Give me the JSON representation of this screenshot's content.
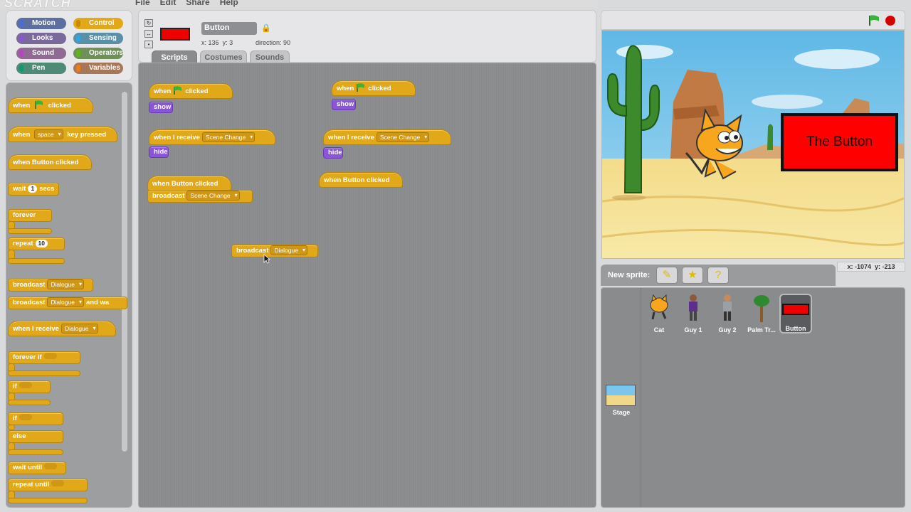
{
  "app": {
    "logo": "SCRATCH",
    "menu": [
      "File",
      "Edit",
      "Share",
      "Help"
    ]
  },
  "categories": [
    {
      "label": "Motion",
      "color": "#4a6cd4"
    },
    {
      "label": "Control",
      "color": "#e1a91a"
    },
    {
      "label": "Looks",
      "color": "#8a55d7"
    },
    {
      "label": "Sensing",
      "color": "#2ca5e2"
    },
    {
      "label": "Sound",
      "color": "#bb42c3"
    },
    {
      "label": "Operators",
      "color": "#5cb712"
    },
    {
      "label": "Pen",
      "color": "#0e9a6c"
    },
    {
      "label": "Variables",
      "color": "#ee7d16"
    }
  ],
  "palette": {
    "when_flag_a": "when",
    "when_flag_b": "clicked",
    "when_key_a": "when",
    "when_key_key": "space",
    "when_key_b": "key pressed",
    "when_clicked": "when Button clicked",
    "wait_a": "wait",
    "wait_num": "1",
    "wait_b": "secs",
    "forever": "forever",
    "repeat": "repeat",
    "repeat_num": "10",
    "broadcast": "broadcast",
    "broadcast_msg": "Dialogue",
    "broadcast_wait": "broadcast",
    "broadcast_wait_msg": "Dialogue",
    "broadcast_wait_b": "and wa",
    "when_receive": "when I receive",
    "when_receive_msg": "Dialogue",
    "forever_if": "forever if",
    "if": "if",
    "if2": "if",
    "else": "else",
    "wait_until": "wait until",
    "repeat_until": "repeat until"
  },
  "sprite": {
    "name": "Button",
    "x_label": "x:",
    "x": "136",
    "y_label": "y:",
    "y": "3",
    "direction_label": "direction:",
    "direction": "90",
    "tabs": [
      "Scripts",
      "Costumes",
      "Sounds"
    ]
  },
  "scripts": {
    "s1_when": "when",
    "s1_clicked": "clicked",
    "s1_show": "show",
    "s2_receive": "when I receive",
    "s2_msg": "Scene Change",
    "s2_hide": "hide",
    "s3_hat": "when Button clicked",
    "s3_broadcast": "broadcast",
    "s3_msg": "Scene Change",
    "s4_broadcast": "broadcast",
    "s4_msg": "Dialogue",
    "s5_when": "when",
    "s5_clicked": "clicked",
    "s5_show": "show",
    "s6_receive": "when I receive",
    "s6_msg": "Scene Change",
    "s6_hide": "hide",
    "s7_hat": "when Button clicked"
  },
  "stage": {
    "button_text": "The Button",
    "mouse_x_label": "x:",
    "mouse_x": "-1074",
    "mouse_y_label": "y:",
    "mouse_y": "-213"
  },
  "new_sprite": {
    "label": "New sprite:"
  },
  "sprite_list": [
    "Cat",
    "Guy 1",
    "Guy 2",
    "Palm Tr...",
    "Button"
  ],
  "stage_label": "Stage"
}
